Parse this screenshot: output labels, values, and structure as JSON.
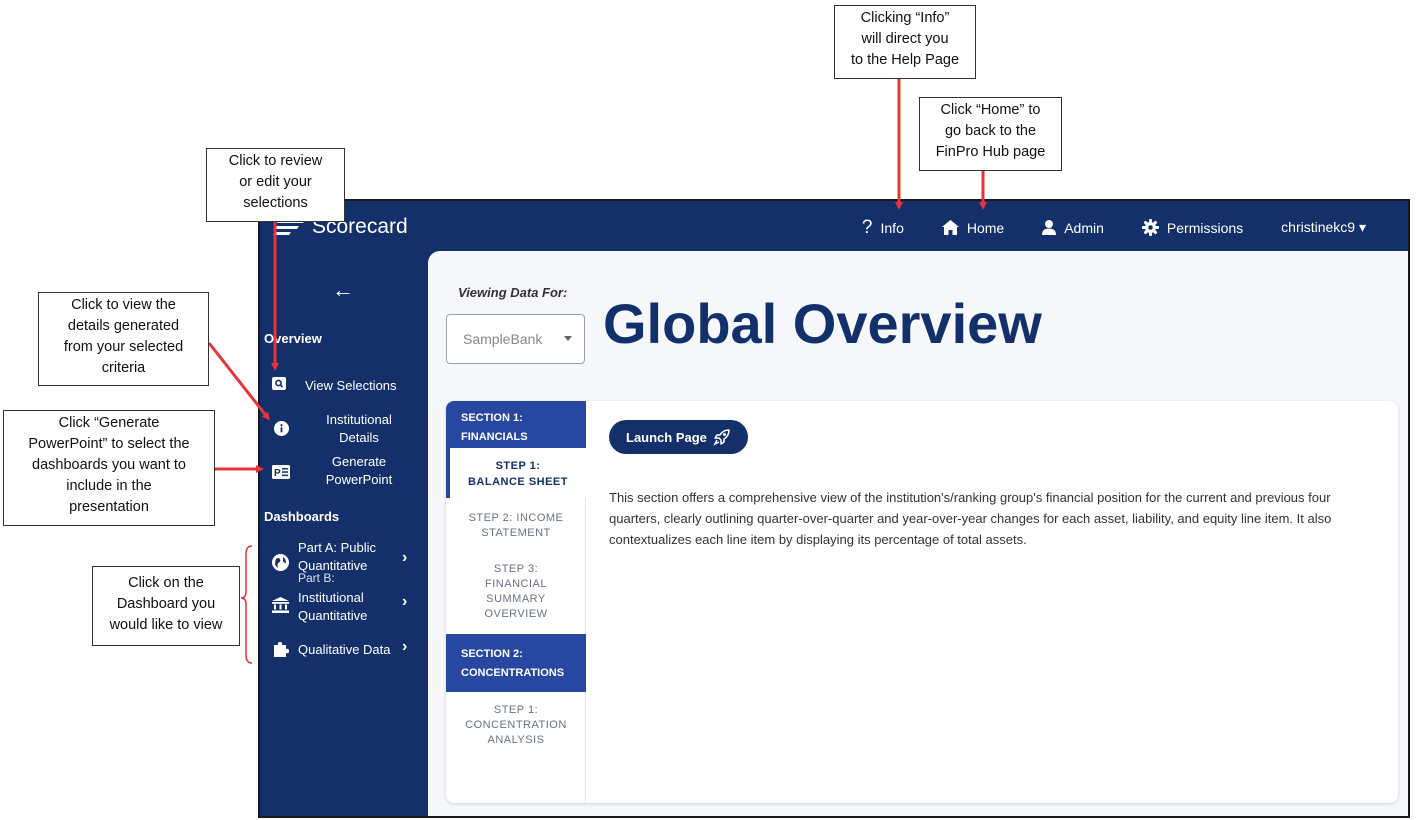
{
  "app": {
    "title": "Scorecard",
    "accent_color": "#13306a",
    "section_color": "#2747a0"
  },
  "nav": {
    "items": [
      {
        "label": "Info",
        "icon": "question-icon"
      },
      {
        "label": "Home",
        "icon": "home-icon"
      },
      {
        "label": "Admin",
        "icon": "user-icon"
      },
      {
        "label": "Permissions",
        "icon": "gear-icon"
      },
      {
        "label": "christinekc9 ▾",
        "icon": "user-menu"
      }
    ]
  },
  "sidebar": {
    "back": "←",
    "overview_heading": "Overview",
    "view_selections": "View Selections",
    "institutional_details": [
      "Institutional",
      "Details"
    ],
    "generate_powerpoint": [
      "Generate",
      "PowerPoint"
    ],
    "dashboards_heading": "Dashboards",
    "part_a": [
      "Part A: Public",
      "Quantitative"
    ],
    "part_b_overlap": "Part B:",
    "part_b": [
      "Institutional",
      "Quantitative"
    ],
    "qualitative": "Qualitative Data",
    "chevron": "›"
  },
  "main": {
    "viewing_label": "Viewing Data For:",
    "bank_selected": "SampleBank",
    "page_title": "Global Overview",
    "launch_label": "Launch Page",
    "description": "This section offers a comprehensive view of the institution's/ranking group's financial position for the current and previous four quarters, clearly outlining quarter-over-quarter and year-over-year changes for each asset, liability, and equity line item. It also contextualizes each line item by displaying its percentage of total assets.",
    "steps_panel": {
      "section1": [
        "SECTION 1:",
        "FINANCIALS"
      ],
      "step1": [
        "STEP 1:",
        "BALANCE SHEET"
      ],
      "step2": [
        "STEP 2: INCOME",
        "STATEMENT"
      ],
      "step3": [
        "STEP 3:",
        "FINANCIAL",
        "SUMMARY",
        "OVERVIEW"
      ],
      "section2": [
        "SECTION 2:",
        "CONCENTRATIONS"
      ],
      "step1b": [
        "STEP 1:",
        "CONCENTRATION",
        "ANALYSIS"
      ]
    }
  },
  "callouts": {
    "info": [
      "Clicking “Info”",
      "will direct you",
      "to the Help Page"
    ],
    "home": [
      "Click “Home” to",
      "go back to the",
      "FinPro Hub page"
    ],
    "review": [
      "Click to review",
      "or edit your",
      "selections"
    ],
    "details": [
      "Click to view the",
      "details generated",
      "from your selected",
      "criteria"
    ],
    "powerpoint": [
      "Click “Generate",
      "PowerPoint” to select the",
      "dashboards you want to",
      "include in the",
      "presentation"
    ],
    "dashboard": [
      "Click on the",
      "Dashboard you",
      "would like to view"
    ]
  },
  "annotation_color": "#e8333a"
}
